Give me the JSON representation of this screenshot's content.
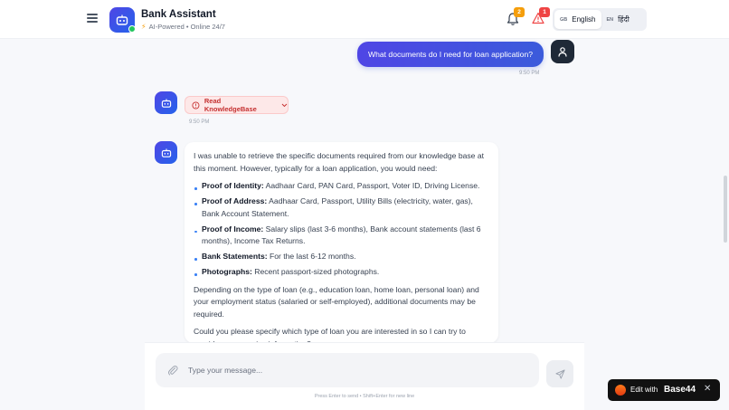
{
  "header": {
    "title": "Bank Assistant",
    "subtitle": "AI-Powered • Online 24/7",
    "notifications_count": "2",
    "alerts_count": "1",
    "languages": [
      {
        "code": "GB",
        "name": "English",
        "active": true
      },
      {
        "code": "EN",
        "name": "हिंदी",
        "active": false
      }
    ]
  },
  "messages": {
    "user_text": "What documents do I need for loan application?",
    "user_time": "9:50 PM",
    "tool_chip_label": "Read KnowledgeBase",
    "tool_time": "9:50 PM",
    "reply": {
      "intro": "I was unable to retrieve the specific documents required from our knowledge base at this moment. However, typically for a loan application, you would need:",
      "items": [
        {
          "label": "Proof of Identity:",
          "text": " Aadhaar Card, PAN Card, Passport, Voter ID, Driving License."
        },
        {
          "label": "Proof of Address:",
          "text": " Aadhaar Card, Passport, Utility Bills (electricity, water, gas), Bank Account Statement."
        },
        {
          "label": "Proof of Income:",
          "text": " Salary slips (last 3-6 months), Bank account statements (last 6 months), Income Tax Returns."
        },
        {
          "label": "Bank Statements:",
          "text": " For the last 6-12 months."
        },
        {
          "label": "Photographs:",
          "text": " Recent passport-sized photographs."
        }
      ],
      "para2": "Depending on the type of loan (e.g., education loan, home loan, personal loan) and your employment status (salaried or self-employed), additional documents may be required.",
      "para3": "Could you please specify which type of loan you are interested in so I can try to provide more precise information?"
    }
  },
  "composer": {
    "placeholder": "Type your message...",
    "hint": "Press Enter to send • Shift+Enter for new line"
  },
  "badge": {
    "prefix": "Edit with",
    "brand": "Base44",
    "close": "✕"
  },
  "colors": {
    "accent": "#4f46e5",
    "alert": "#ef4444",
    "warning": "#f59e0b",
    "online": "#22c55e"
  }
}
